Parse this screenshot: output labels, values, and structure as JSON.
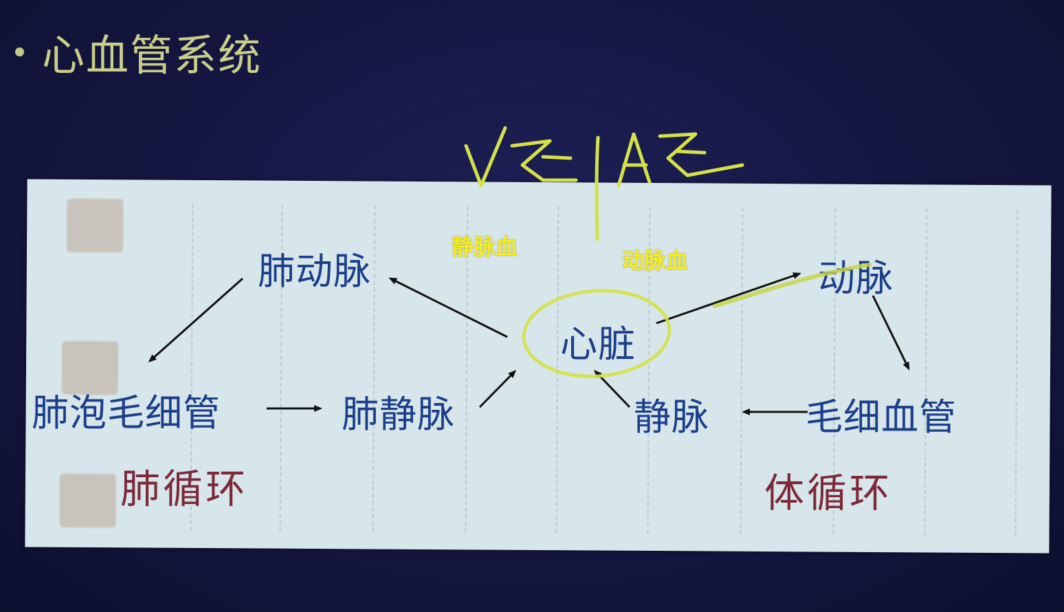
{
  "slide": {
    "title": "心血管系统"
  },
  "diagram": {
    "nodes": {
      "heart": "心脏",
      "pulmonary_artery": "肺动脉",
      "alveolar_capillary": "肺泡毛细管",
      "pulmonary_vein": "肺静脉",
      "artery": "动脉",
      "capillary": "毛细血管",
      "vein": "静脉"
    },
    "circulations": {
      "pulmonary": "肺循环",
      "systemic": "体循环"
    },
    "annotations": {
      "venous_blood": "静脉血",
      "arterial_blood": "动脉血"
    }
  },
  "colors": {
    "background": "#161944",
    "title": "#c9ce8a",
    "panel": "#d7e6ea",
    "node_text": "#1c3f8a",
    "circulation_text": "#7c2a3a",
    "annotation_text": "#f7ee17",
    "handwriting": "#d6e04a"
  },
  "handwriting": {
    "description_icon": "handwritten-vtext-slash-atext"
  }
}
